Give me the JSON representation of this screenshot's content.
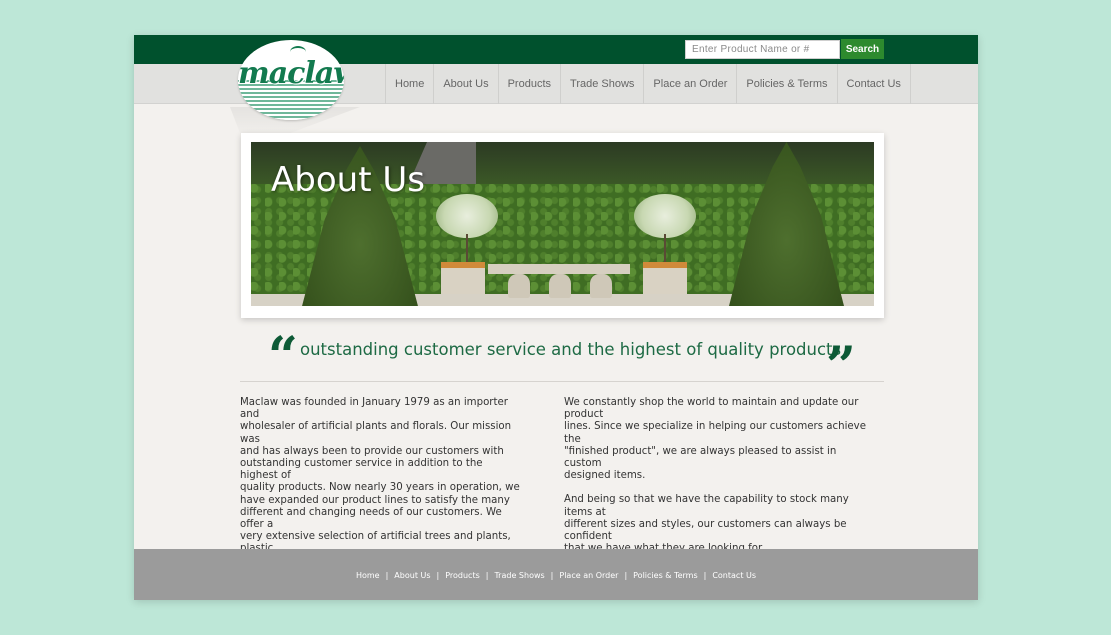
{
  "search": {
    "placeholder": "Enter Product Name or #",
    "button_label": "Search"
  },
  "logo": {
    "text": "maclaw"
  },
  "nav": {
    "items": [
      {
        "label": "Home"
      },
      {
        "label": "About Us"
      },
      {
        "label": "Products"
      },
      {
        "label": "Trade Shows"
      },
      {
        "label": "Place an Order"
      },
      {
        "label": "Policies & Terms"
      },
      {
        "label": "Contact Us"
      }
    ]
  },
  "hero": {
    "title": "About Us"
  },
  "tagline": {
    "open_quote": "“",
    "text": "outstanding customer service and the highest of quality products",
    "close_quote": "”"
  },
  "content": {
    "left_paragraph": "Maclaw was founded in January 1979 as an importer and\nwholesaler of artificial plants and florals. Our mission was\nand has always been to provide our customers with\noutstanding customer service in addition to the highest of\nquality products. Now nearly 30 years in operation, we\nhave expanded our product lines to satisfy the many\ndifferent and changing needs of our customers. We offer a\nvery extensive selection of artificial trees and plants, plastic\neverlasting indoor/outdoor plants and topiaries, greenery\nand pots & planters.",
    "right_paragraph_1": "We constantly shop the world to maintain and update our product\nlines. Since we specialize in helping our customers achieve the\n\"finished product\", we are always pleased to assist in custom\ndesigned items.",
    "right_paragraph_2": "And being so that we have the capability to stock many items at\ndifferent sizes and styles, our customers can always be confident\nthat we have what they are looking for."
  },
  "footer": {
    "links": [
      {
        "label": "Home"
      },
      {
        "label": "About Us"
      },
      {
        "label": "Products"
      },
      {
        "label": "Trade Shows"
      },
      {
        "label": "Place an Order"
      },
      {
        "label": "Policies & Terms"
      },
      {
        "label": "Contact Us"
      }
    ],
    "separator": "|"
  },
  "colors": {
    "page_background": "#bde7d7",
    "top_bar": "#00512d",
    "search_button": "#2d8a2e",
    "tagline": "#1d6a44",
    "footer": "#9b9b9b"
  }
}
